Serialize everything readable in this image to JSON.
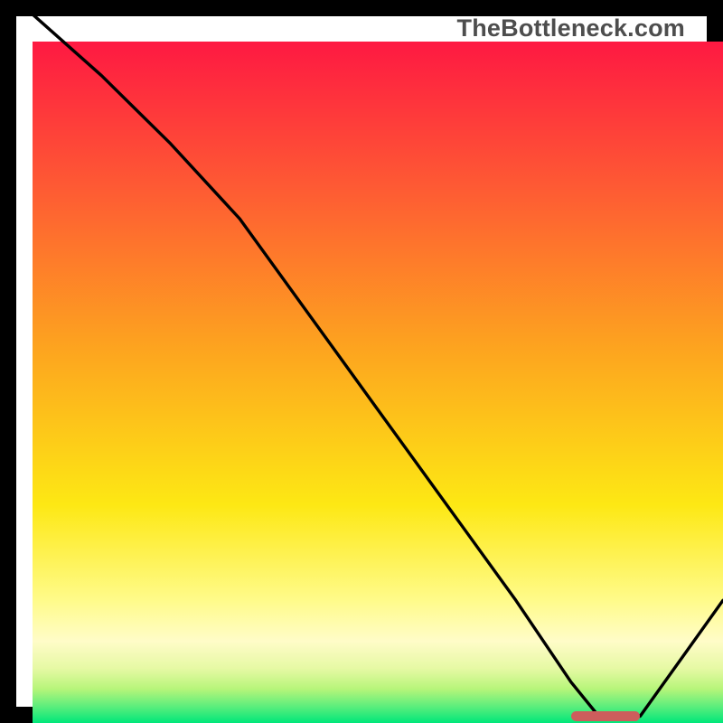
{
  "watermark": "TheBottleneck.com",
  "colors": {
    "grad_top": "#fe1942",
    "grad_mid1": "#fd8b2a",
    "grad_mid2": "#fde814",
    "grad_pale": "#fffcb4",
    "grad_greenish": "#b7f57a",
    "grad_green": "#00e77a",
    "curve": "#000000",
    "marker": "#cd5d5c",
    "frame": "#000000"
  },
  "chart_data": {
    "type": "line",
    "title": "",
    "xlabel": "",
    "ylabel": "",
    "xlim": [
      0,
      100
    ],
    "ylim": [
      0,
      100
    ],
    "series": [
      {
        "name": "bottleneck-curve",
        "x": [
          0,
          10,
          20,
          30,
          40,
          50,
          60,
          70,
          78,
          82,
          88,
          100
        ],
        "y": [
          104,
          95,
          85,
          74,
          60,
          46,
          32,
          18,
          6,
          1,
          1,
          18
        ]
      }
    ],
    "annotations": {
      "optimal_range_x": [
        78,
        88
      ],
      "optimal_y": 1
    }
  }
}
